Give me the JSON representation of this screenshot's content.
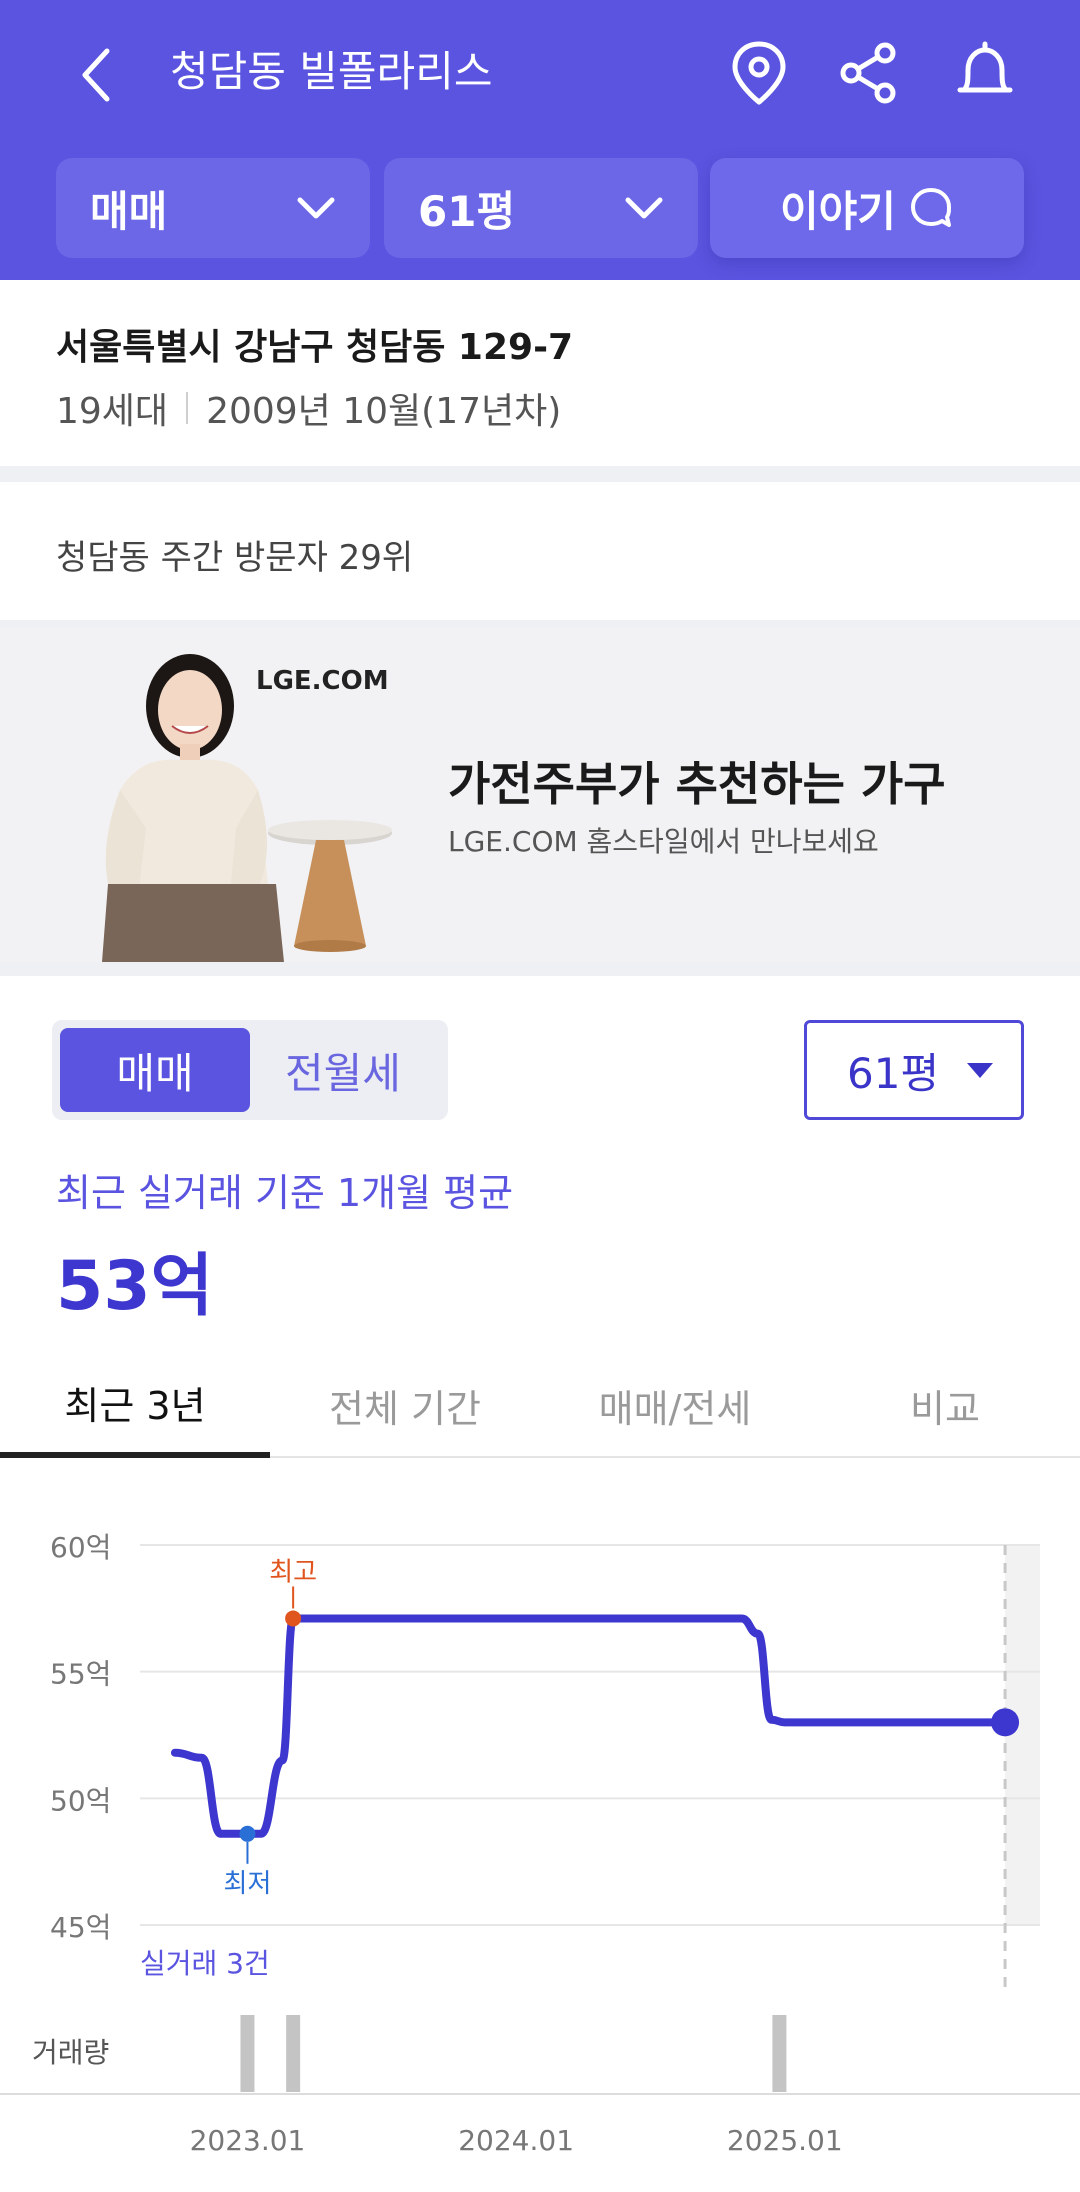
{
  "header": {
    "title": "청담동 빌폴라리스",
    "filters": {
      "trade_type": "매매",
      "size": "61평",
      "talk": "이야기"
    }
  },
  "property": {
    "address": "서울특별시 강남구 청담동 129-7",
    "households": "19세대",
    "built": "2009년 10월(17년차)"
  },
  "rank_text": "청담동 주간 방문자 29위",
  "ad": {
    "brand": "LGE.COM",
    "headline": "가전주부가 추천하는 가구",
    "sub": "LGE.COM 홈스타일에서 만나보세요"
  },
  "price_section": {
    "segments": [
      "매매",
      "전월세"
    ],
    "selected_segment": "매매",
    "size": "61평",
    "avg_label": "최근 실거래 기준 1개월 평균",
    "avg_value": "53억"
  },
  "tabs": [
    {
      "label": "최근 3년",
      "active": true
    },
    {
      "label": "전체 기간",
      "active": false
    },
    {
      "label": "매매/전세",
      "active": false
    },
    {
      "label": "비교",
      "active": false
    }
  ],
  "colors": {
    "primary": "#5a54e0",
    "line": "#3e37cf",
    "high": "#e0541e",
    "low": "#2a6fd6"
  },
  "chart_data": {
    "type": "line",
    "y_tick_labels": [
      "60억",
      "55억",
      "50억",
      "45억"
    ],
    "y_ticks": [
      60,
      55,
      50,
      45
    ],
    "ylim": [
      45,
      60
    ],
    "x_tick_labels": [
      "2023.01",
      "2024.01",
      "2025.01"
    ],
    "x_ticks": [
      2023.0,
      2024.0,
      2025.0
    ],
    "xlim": [
      2022.6,
      2025.95
    ],
    "series": [
      {
        "values": [
          {
            "x": 2022.73,
            "y": 51.8
          },
          {
            "x": 2022.83,
            "y": 51.6
          },
          {
            "x": 2022.9,
            "y": 48.6
          },
          {
            "x": 2023.05,
            "y": 48.6
          },
          {
            "x": 2023.13,
            "y": 51.5
          },
          {
            "x": 2023.17,
            "y": 57.1
          },
          {
            "x": 2024.84,
            "y": 57.1
          },
          {
            "x": 2024.9,
            "y": 56.5
          },
          {
            "x": 2024.95,
            "y": 53.1
          },
          {
            "x": 2025.0,
            "y": 53.0
          },
          {
            "x": 2025.82,
            "y": 53.0
          }
        ]
      }
    ],
    "high": {
      "label": "최고",
      "x": 2023.17,
      "y": 57.1
    },
    "low": {
      "label": "최저",
      "x": 2023.0,
      "y": 48.6
    },
    "current": {
      "x": 2025.82,
      "y": 53.0
    },
    "trade_count_label": "실거래 3건",
    "volume_label": "거래량",
    "volume_bars": [
      {
        "x": 2023.0,
        "count": 1
      },
      {
        "x": 2023.17,
        "count": 1
      },
      {
        "x": 2024.98,
        "count": 1
      }
    ],
    "grid": true
  }
}
